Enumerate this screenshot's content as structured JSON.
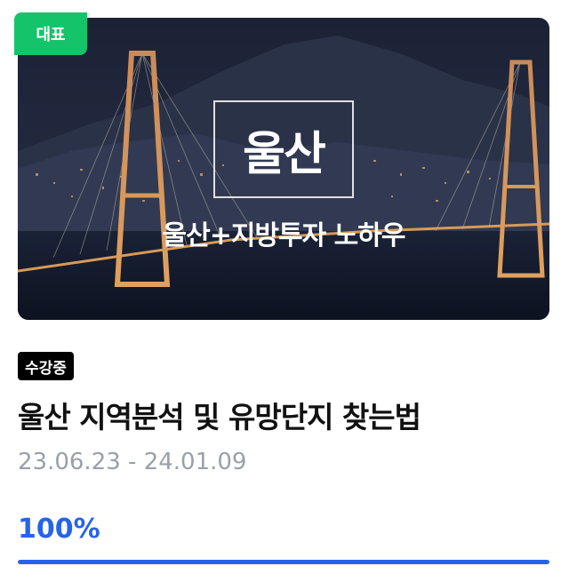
{
  "card": {
    "badge_label": "대표",
    "thumbnail": {
      "title": "울산",
      "subtitle": "울산+지방투자 노하우"
    },
    "status_label": "수강중",
    "course_title": "울산 지역분석 및 유망단지 찾는법",
    "date_range": "23.06.23 - 24.01.09",
    "progress_label": "100%",
    "progress_value": 1.0,
    "colors": {
      "badge_green": "#15c46a",
      "progress_blue": "#2563eb",
      "status_black": "#000000"
    }
  }
}
